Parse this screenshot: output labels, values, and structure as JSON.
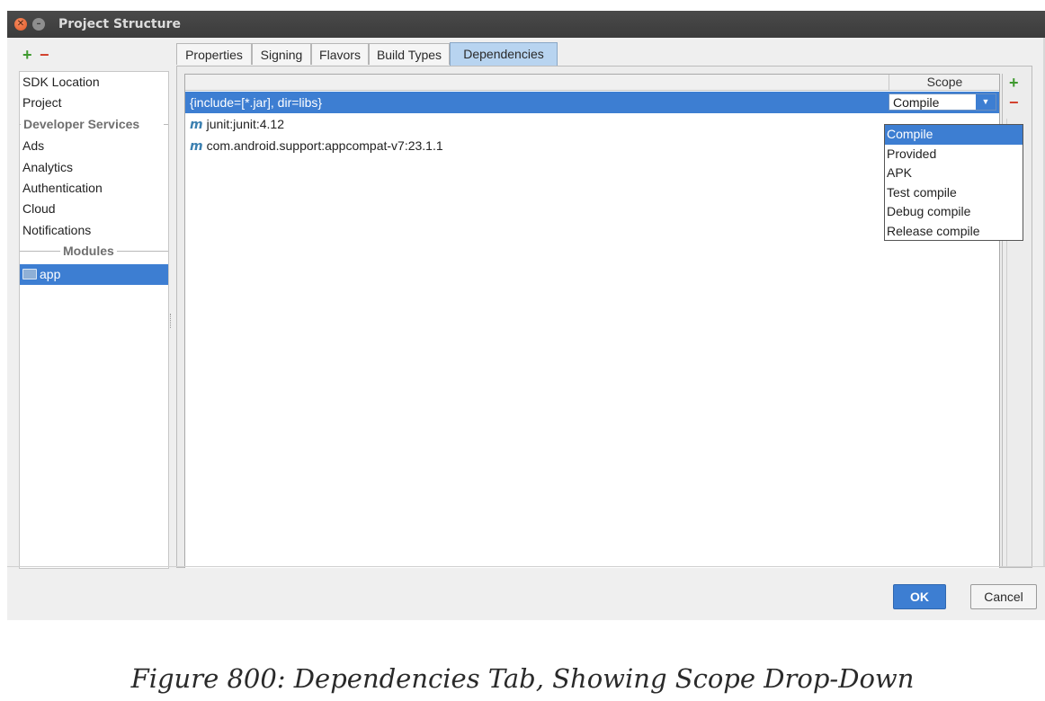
{
  "window": {
    "title": "Project Structure"
  },
  "left_toolbar": {
    "add": "+",
    "remove": "−"
  },
  "sidebar": {
    "items": [
      {
        "label": "SDK Location"
      },
      {
        "label": "Project"
      },
      {
        "separator": "Developer Services"
      },
      {
        "label": "Ads"
      },
      {
        "label": "Analytics"
      },
      {
        "label": "Authentication"
      },
      {
        "label": "Cloud"
      },
      {
        "label": "Notifications"
      },
      {
        "separator": "Modules"
      },
      {
        "label": "app",
        "icon": "folder-icon",
        "selected": true
      }
    ]
  },
  "tabs": [
    {
      "label": "Properties"
    },
    {
      "label": "Signing"
    },
    {
      "label": "Flavors"
    },
    {
      "label": "Build Types"
    },
    {
      "label": "Dependencies",
      "active": true
    }
  ],
  "dependencies": {
    "header": {
      "scope": "Scope"
    },
    "rows": [
      {
        "name": "{include=[*.jar], dir=libs}",
        "scope": "Compile",
        "selected": true
      },
      {
        "icon": "m",
        "name": "junit:junit:4.12"
      },
      {
        "icon": "m",
        "name": "com.android.support:appcompat-v7:23.1.1"
      }
    ],
    "tools": {
      "add": "+",
      "remove": "−"
    }
  },
  "scope_dropdown": {
    "selected": "Compile",
    "options": [
      "Compile",
      "Provided",
      "APK",
      "Test compile",
      "Debug compile",
      "Release compile"
    ]
  },
  "buttons": {
    "ok": "OK",
    "cancel": "Cancel"
  },
  "caption": "Figure 800: Dependencies Tab, Showing Scope Drop-Down",
  "colors": {
    "selection": "#3d7ed2",
    "add": "#3f9a2f",
    "remove": "#d2402c",
    "titlebar": "#3b3b3b"
  }
}
